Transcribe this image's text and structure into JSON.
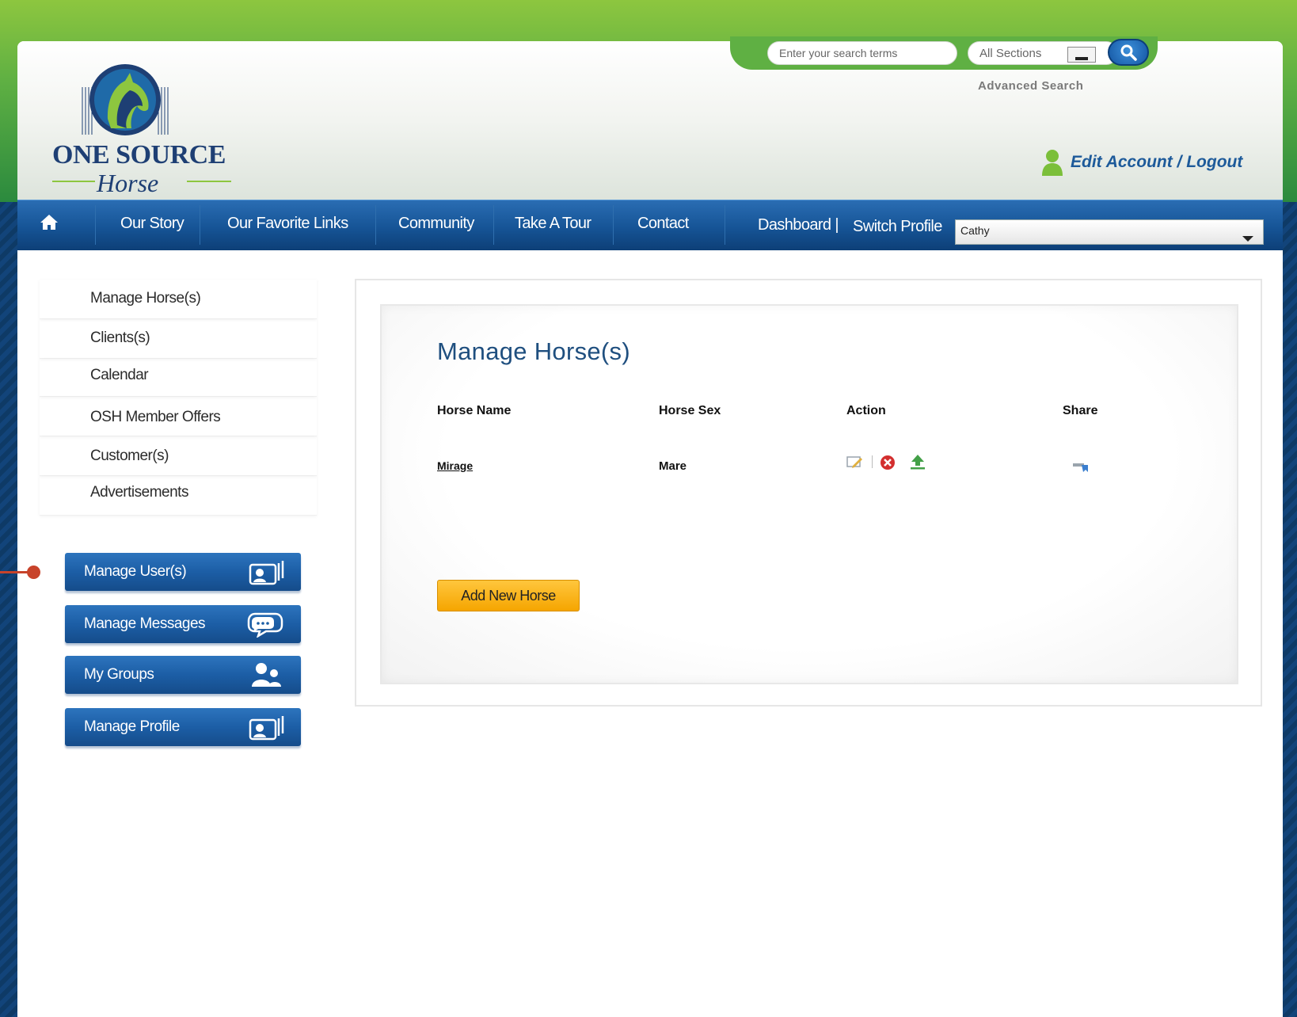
{
  "brand": {
    "name_line1": "ONE SOURCE",
    "name_line2": "Horse",
    "green": "#5fb043",
    "blue": "#165496"
  },
  "search": {
    "placeholder": "Enter your search terms",
    "section_value": "All Sections",
    "advanced_label": "Advanced Search"
  },
  "account": {
    "link_label": "Edit Account / Logout"
  },
  "nav": {
    "items": [
      "Our Story",
      "Our Favorite Links",
      "Community",
      "Take A Tour",
      "Contact"
    ],
    "dashboard_label": "Dashboard |",
    "switch_profile_label": "Switch Profile",
    "profile_value": "Cathy"
  },
  "sidebar": {
    "links": [
      "Manage Horse(s)",
      "Clients(s)",
      "Calendar",
      "OSH Member Offers",
      "Customer(s)",
      "Advertisements"
    ],
    "buttons": [
      "Manage User(s)",
      "Manage Messages",
      "My Groups",
      "Manage Profile"
    ]
  },
  "main": {
    "title": "Manage Horse(s)",
    "columns": [
      "Horse Name",
      "Horse Sex",
      "Action",
      "Share"
    ],
    "rows": [
      {
        "name": "Mirage",
        "sex": "Mare"
      }
    ],
    "add_button_label": "Add New Horse"
  }
}
